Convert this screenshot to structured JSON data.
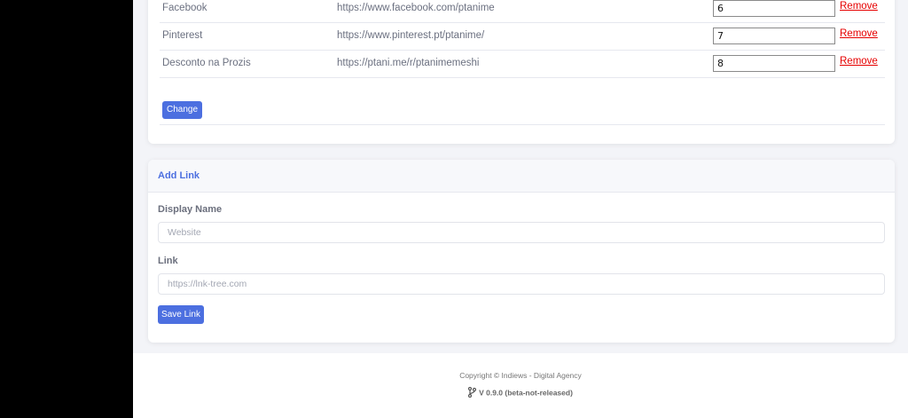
{
  "links": [
    {
      "name": "Facebook",
      "url": "https://www.facebook.com/ptanime",
      "order": "6",
      "remove": "Remove"
    },
    {
      "name": "Pinterest",
      "url": "https://www.pinterest.pt/ptanime/",
      "order": "7",
      "remove": "Remove"
    },
    {
      "name": "Desconto na Prozis",
      "url": "https://ptani.me/r/ptanimemeshi",
      "order": "8",
      "remove": "Remove"
    }
  ],
  "change_label": "Change",
  "add_link": {
    "title": "Add Link",
    "display_name_label": "Display Name",
    "display_name_placeholder": "Website",
    "link_label": "Link",
    "link_placeholder": "https://lnk-tree.com",
    "save_label": "Save Link"
  },
  "footer": {
    "copyright": "Copyright © Indiews - Digital Agency",
    "version": "V 0.9.0 (beta-not-released)"
  },
  "colors": {
    "accent": "#4c6fe0",
    "danger": "#e60000"
  },
  "icons": {
    "version": "git-branch-icon"
  }
}
